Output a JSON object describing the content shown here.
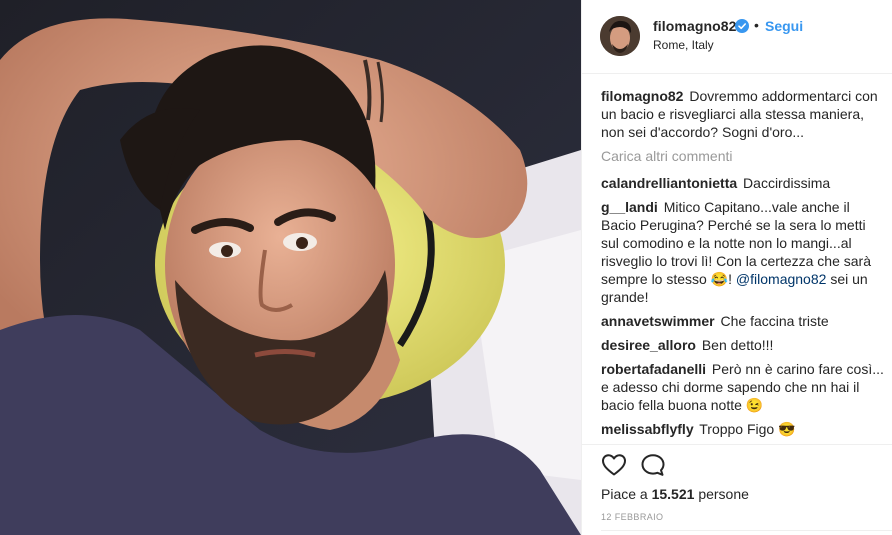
{
  "post": {
    "username": "filomagno82",
    "follow_label": "Segui",
    "separator": "•",
    "location": "Rome, Italy",
    "caption_user": "filomagno82",
    "caption_text": "Dovremmo addormentarci con un bacio e risvegliarci alla stessa maniera, non sei d'accordo? Sogni d'oro...",
    "load_more": "Carica altri commenti",
    "likes_prefix": "Piace a",
    "likes_count": "15.521",
    "likes_suffix": "persone",
    "date": "12 FEBBRAIO"
  },
  "comments": [
    {
      "user": "calandrelliantonietta",
      "text": "Daccirdissima"
    },
    {
      "user": "g__landi",
      "text": "Mitico Capitano...vale anche il Bacio Perugina? Perché se la sera lo metti sul comodino e la notte non lo mangi...al risveglio lo trovi lì! Con la certezza che sarà sempre lo stesso 😂!",
      "mention": "@filomagno82",
      "text_after": "sei un grande!"
    },
    {
      "user": "annavetswimmer",
      "text": "Che faccina triste"
    },
    {
      "user": "desiree_alloro",
      "text": "Ben detto!!!"
    },
    {
      "user": "robertafadanelli",
      "text": "Però nn è carino fare così... e adesso chi dorme sapendo che nn hai il bacio fella buona notte 😉"
    },
    {
      "user": "melissabflyfly",
      "text": "Troppo Figo 😎"
    }
  ],
  "icons": {
    "verified": "verified-badge-icon",
    "like": "heart-outline-icon",
    "comment": "speech-bubble-icon"
  },
  "colors": {
    "link_blue": "#3897f0",
    "muted": "#999999",
    "text": "#262626"
  }
}
